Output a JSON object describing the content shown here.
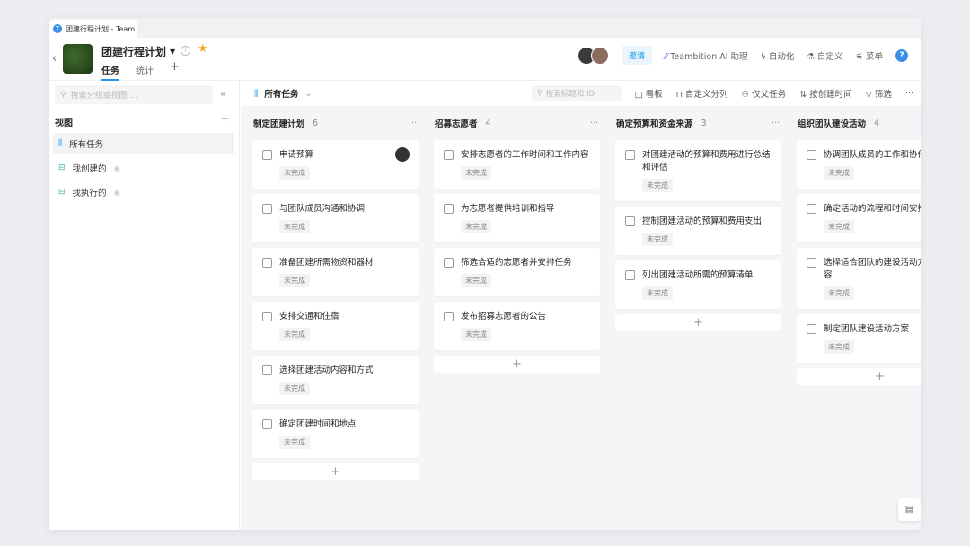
{
  "browser_tab": {
    "title": "团建行程计划 - Team"
  },
  "project": {
    "title": "团建行程计划",
    "tabs": [
      "任务",
      "统计"
    ],
    "add": "+"
  },
  "header": {
    "invite": "邀请",
    "ai": "Teambition AI 助理",
    "automation": "自动化",
    "customize": "自定义",
    "menu": "菜单",
    "help": "?"
  },
  "sidebar": {
    "search_placeholder": "搜索分组或视图 ...",
    "views_heading": "视图",
    "add": "+",
    "items": [
      {
        "label": "所有任务",
        "icon": "board-icon"
      },
      {
        "label": "我创建的",
        "icon": "table-icon"
      },
      {
        "label": "我执行的",
        "icon": "table-icon"
      }
    ]
  },
  "toolbar": {
    "view": "所有任务",
    "search_placeholder": "搜索标题和 ID",
    "board": "看板",
    "custom_columns": "自定义分列",
    "parent_only": "仅父任务",
    "sort": "按创建时间",
    "filter": "筛选",
    "more": "···"
  },
  "columns": [
    {
      "title": "制定团建计划",
      "count": "6",
      "tasks": [
        "申请预算",
        "与团队成员沟通和协调",
        "准备团建所需物资和器材",
        "安排交通和住宿",
        "选择团建活动内容和方式",
        "确定团建时间和地点"
      ]
    },
    {
      "title": "招募志愿者",
      "count": "4",
      "tasks": [
        "安排志愿者的工作时间和工作内容",
        "为志愿者提供培训和指导",
        "筛选合适的志愿者并安排任务",
        "发布招募志愿者的公告"
      ]
    },
    {
      "title": "确定预算和资金来源",
      "count": "3",
      "tasks": [
        "对团建活动的预算和费用进行总结和评估",
        "控制团建活动的预算和费用支出",
        "列出团建活动所需的预算清单"
      ]
    },
    {
      "title": "组织团队建设活动",
      "count": "4",
      "tasks": [
        "协调团队成员的工作和协作",
        "确定活动的流程和时间安排",
        "选择适合团队的建设活动方式和内容",
        "制定团队建设活动方案"
      ]
    }
  ],
  "status_label": "未完成",
  "colors": {
    "accent": "#1b9aee",
    "star": "#f5a623"
  }
}
